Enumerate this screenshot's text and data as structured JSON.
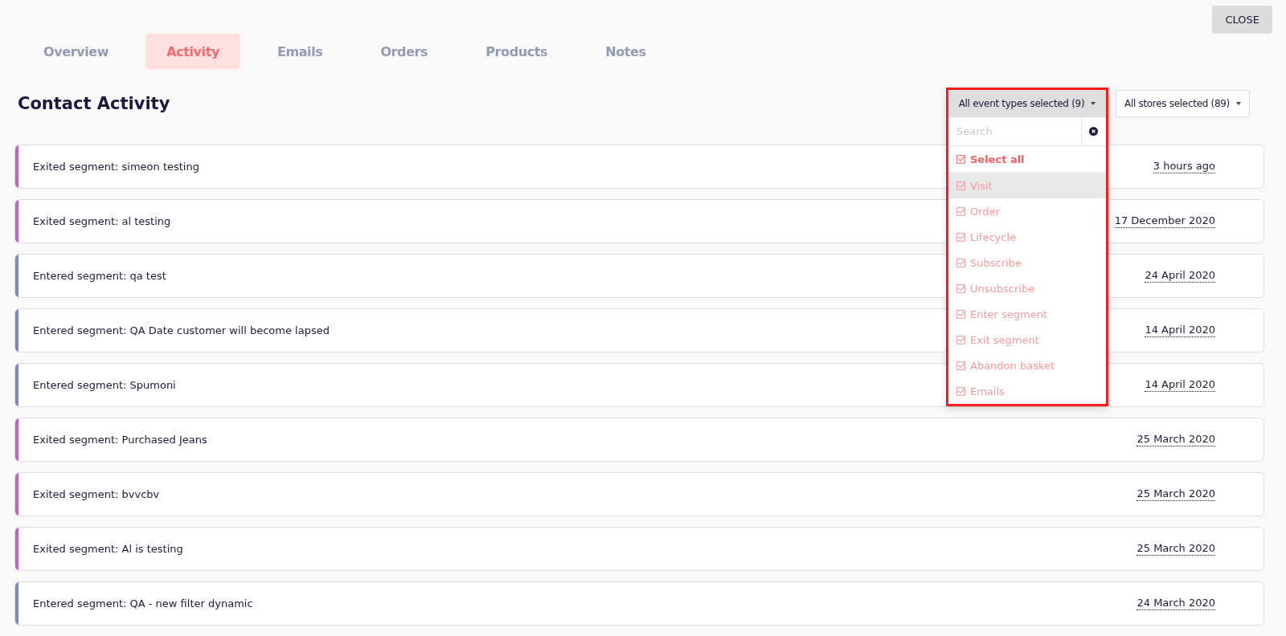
{
  "close_button": "CLOSE",
  "tabs": [
    {
      "label": "Overview",
      "selected": false
    },
    {
      "label": "Activity",
      "selected": true
    },
    {
      "label": "Emails",
      "selected": false
    },
    {
      "label": "Orders",
      "selected": false
    },
    {
      "label": "Products",
      "selected": false
    },
    {
      "label": "Notes",
      "selected": false
    }
  ],
  "title": "Contact Activity",
  "event_filter": {
    "label": "All event types selected (9)",
    "search_placeholder": "Search",
    "select_all": {
      "label": "Select all",
      "checked": true
    },
    "options": [
      {
        "label": "Visit",
        "checked": true,
        "highlighted": true
      },
      {
        "label": "Order",
        "checked": true,
        "highlighted": false
      },
      {
        "label": "Lifecycle",
        "checked": true,
        "highlighted": false
      },
      {
        "label": "Subscribe",
        "checked": true,
        "highlighted": false
      },
      {
        "label": "Unsubscribe",
        "checked": true,
        "highlighted": false
      },
      {
        "label": "Enter segment",
        "checked": true,
        "highlighted": false
      },
      {
        "label": "Exit segment",
        "checked": true,
        "highlighted": false
      },
      {
        "label": "Abandon basket",
        "checked": true,
        "highlighted": false
      },
      {
        "label": "Emails",
        "checked": true,
        "highlighted": false
      }
    ]
  },
  "store_filter": {
    "label": "All stores selected (89)"
  },
  "activities": [
    {
      "text": "Exited segment: simeon testing",
      "time": "3 hours ago",
      "color": "#c162cc"
    },
    {
      "text": "Exited segment: al testing",
      "time": "17 December 2020",
      "color": "#c162cc"
    },
    {
      "text": "Entered segment: qa test",
      "time": "24 April 2020",
      "color": "#7b86cc"
    },
    {
      "text": "Entered segment: QA Date customer will become lapsed",
      "time": "14 April 2020",
      "color": "#7b86cc"
    },
    {
      "text": "Entered segment: Spumoni",
      "time": "14 April 2020",
      "color": "#7b86cc"
    },
    {
      "text": "Exited segment: Purchased Jeans",
      "time": "25 March 2020",
      "color": "#c162cc"
    },
    {
      "text": "Exited segment: bvvcbv",
      "time": "25 March 2020",
      "color": "#c162cc"
    },
    {
      "text": "Exited segment: Al is testing",
      "time": "25 March 2020",
      "color": "#c162cc"
    },
    {
      "text": "Entered segment: QA - new filter dynamic",
      "time": "24 March 2020",
      "color": "#7b86cc"
    }
  ]
}
